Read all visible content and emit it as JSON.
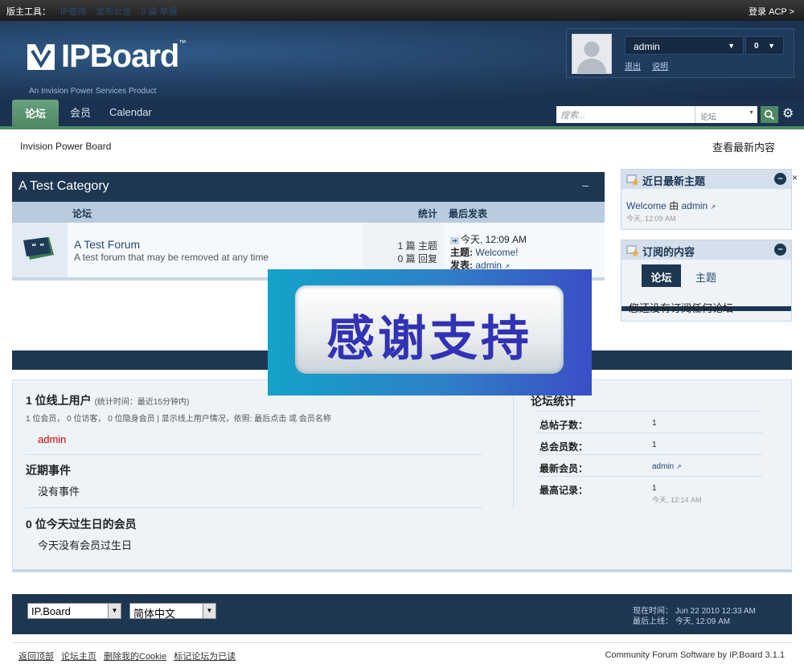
{
  "adminbar": {
    "tools": [
      "版主工具：",
      "IP查询",
      "发布公告",
      "0 篇 举报"
    ],
    "acp": "登录 ACP >"
  },
  "branding": {
    "logo_name": "IPBoard",
    "logo_tm": "™",
    "logo_sub": "An Invision Power Services Product"
  },
  "user": {
    "name": "admin",
    "notifications": "0",
    "links": [
      "退出",
      "说明"
    ]
  },
  "nav": {
    "tabs": [
      "论坛",
      "会员",
      "Calendar"
    ],
    "search_placeholder": "搜索...",
    "search_scope": "论坛"
  },
  "breadcrumb": "Invision Power Board",
  "view_new_content": "查看最新内容",
  "category": {
    "title": "A Test Category",
    "collapse": "–",
    "columns": {
      "forum": "论坛",
      "stats": "统计",
      "last_post": "最后发表"
    },
    "forum": {
      "title": "A Test Forum",
      "description": "A test forum that may be removed at any time",
      "topics": "1 篇 主题",
      "replies": "0 篇 回复",
      "last_time": "今天, 12:09 AM",
      "last_topic_label": "主题:",
      "last_topic": "Welcome!",
      "last_by_label": "发表:",
      "last_by": "admin"
    }
  },
  "sidebar": {
    "recent": {
      "title": "近日最新主题",
      "item_topic": "Welcome",
      "item_by": "由",
      "item_user": "admin",
      "item_time": "今天, 12:09 AM"
    },
    "subscriptions": {
      "title": "订阅的内容",
      "tabs": [
        "论坛",
        "主题"
      ],
      "empty": "您还没有订阅任何论坛"
    },
    "close": "×"
  },
  "stats": {
    "online_title": "1 位线上用户",
    "online_note": "(统计时间：最近15分钟内)",
    "online_detail": "1 位会员， 0 位访客， 0 位隐身会员 | 显示线上用户情况，依照: 最后点击 或 会员名称",
    "online_user": "admin",
    "events_title": "近期事件",
    "events_body": "没有事件",
    "birthdays_title": "0 位今天过生日的会员",
    "birthdays_body": "今天没有会员过生日",
    "board_title": "论坛统计",
    "rows": [
      {
        "label": "总帖子数：",
        "value": "1"
      },
      {
        "label": "总会员数：",
        "value": "1"
      },
      {
        "label": "最新会员：",
        "value": "admin"
      },
      {
        "label": "最高记录：",
        "value": "1",
        "sub": "今天, 12:14 AM"
      }
    ]
  },
  "footer": {
    "skin": "IP.Board",
    "language": "简体中文",
    "time_now": "现在时间： Jun 22 2010 12:33 AM",
    "last_visit": "最后上线： 今天, 12:09 AM",
    "links": [
      "返回顶部",
      "论坛主页",
      "删除我的Cookie",
      "标记论坛为已读"
    ],
    "copyright": "Community Forum Software by IP.Board 3.1.1"
  },
  "overlay": {
    "text": "感谢支持"
  },
  "colors": {
    "nav_dark": "#1d3652",
    "accent_green": "#4f8964",
    "link": "#284b72",
    "online_red": "#cc0000"
  }
}
